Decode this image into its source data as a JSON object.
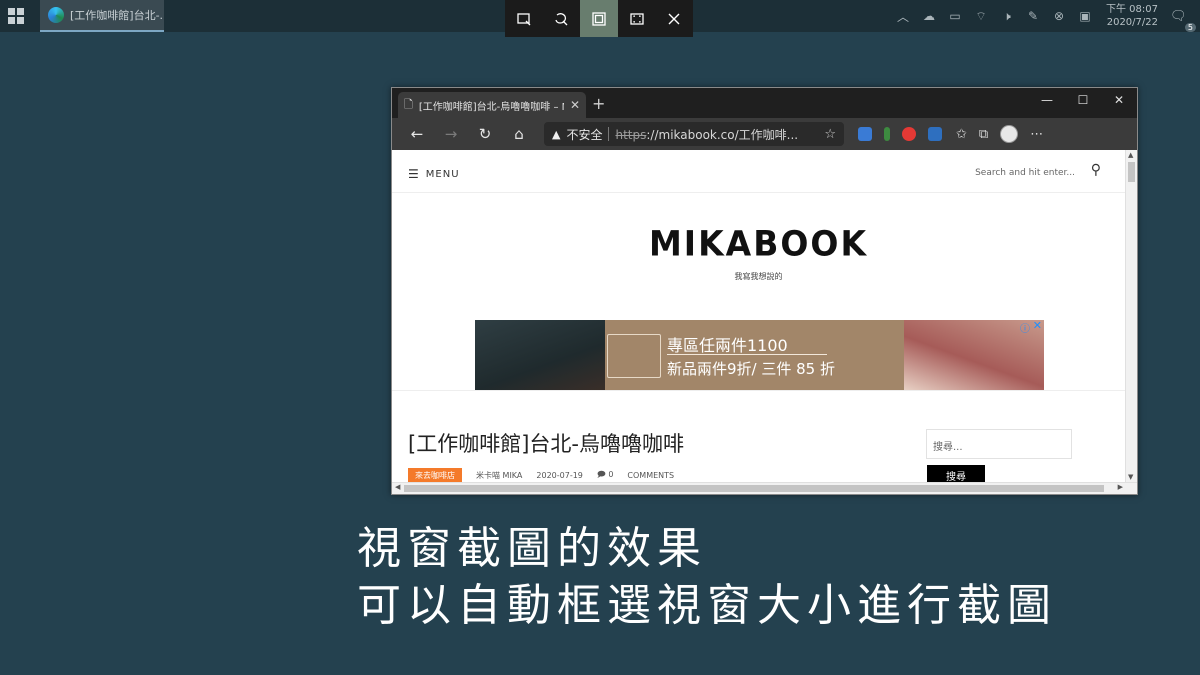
{
  "taskbar": {
    "app_label": "[工作咖啡館]台北-...",
    "clock_period_time": "下午 08:07",
    "clock_date": "2020/7/22",
    "notification_count": "5"
  },
  "snip_toolbar": {
    "buttons": [
      "rectangular-snip",
      "freeform-snip",
      "window-snip",
      "fullscreen-snip",
      "close"
    ],
    "active": "window-snip",
    "active_color": "#687d6e"
  },
  "browser": {
    "tab_title": "[工作咖啡館]台北-烏嚕嚕咖啡 – M",
    "new_tab_label": "+",
    "address": {
      "insecure_label": "不安全",
      "scheme": "https",
      "url_rest": "://mikabook.co/工作咖啡..."
    }
  },
  "page": {
    "menu_label": "MENU",
    "search_placeholder": "Search and hit enter...",
    "brand": "MIKABOOK",
    "tagline": "我寫我想說的",
    "ad": {
      "line1": "專區任兩件1100",
      "line2": "新品兩件9折/ 三件 85 折"
    },
    "post_title": "[工作咖啡館]台北-烏嚕嚕咖啡",
    "meta": {
      "category": "來去咖啡店",
      "author": "米卡喵 MIKA",
      "date": "2020-07-19",
      "comment_count": "0",
      "comments_label": "COMMENTS"
    },
    "sidebar": {
      "search_placeholder": "搜尋...",
      "search_button": "搜尋"
    }
  },
  "caption": {
    "line1": "視窗截圖的效果",
    "line2": "可以自動框選視窗大小進行截圖"
  },
  "colors": {
    "desktop_bg": "#24414f",
    "category_badge": "#f47a2a"
  }
}
